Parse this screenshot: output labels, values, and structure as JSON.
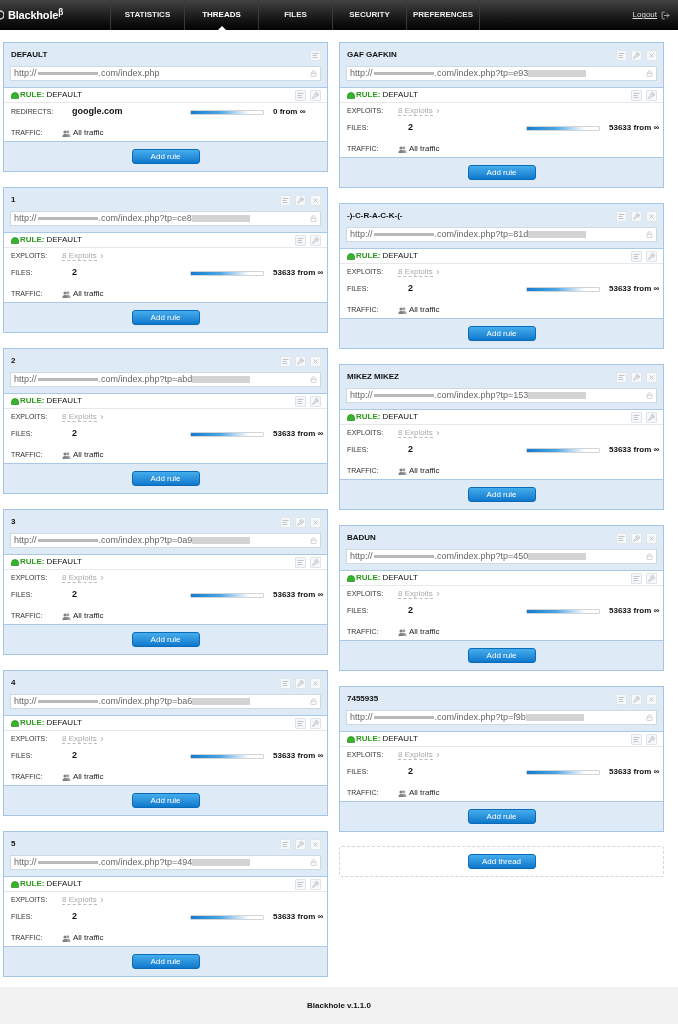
{
  "header": {
    "logo": "Blackhole$^{β}$",
    "nav": [
      {
        "label": "STATISTICS",
        "selected": false
      },
      {
        "label": "THREADS",
        "selected": true
      },
      {
        "label": "FILES",
        "selected": false
      },
      {
        "label": "SECURITY",
        "selected": false
      },
      {
        "label": "PREFERENCES",
        "selected": false
      }
    ],
    "logout": "Logout"
  },
  "columns": [
    [
      {
        "title": "DEFAULT",
        "editable": false,
        "removable": false,
        "url": [
          {
            "kind": "text",
            "text": "http://"
          },
          {
            "kind": "redacted_host"
          },
          {
            "kind": "text",
            "text": ".com/index.php"
          }
        ],
        "rule": {
          "label": "RULE:",
          "name": "DEFAULT"
        },
        "rows": [
          {
            "kind": "meter",
            "label": "REDIRECTS:",
            "value": "google.com",
            "level": 0.8,
            "reading": "0 from ∞"
          },
          {
            "kind": "traffic",
            "label": "TRAFFIC:",
            "value": "All traffic"
          }
        ],
        "button": "Add rule"
      },
      {
        "title": "1",
        "editable": true,
        "removable": true,
        "url": [
          {
            "kind": "text",
            "text": "http://"
          },
          {
            "kind": "redacted_host"
          },
          {
            "kind": "text",
            "text": ".com/index.php?tp=ce8"
          },
          {
            "kind": "redacted_token"
          }
        ],
        "rule": {
          "label": "RULE:",
          "name": "DEFAULT"
        },
        "rows": [
          {
            "kind": "link",
            "label": "EXPLOITS:",
            "value": "8 Exploits"
          },
          {
            "kind": "meter",
            "label": "FILES:",
            "value": "2",
            "level": 0.8,
            "reading": "53633 from ∞"
          },
          {
            "kind": "traffic",
            "label": "TRAFFIC:",
            "value": "All traffic"
          }
        ],
        "button": "Add rule"
      },
      {
        "title": "2",
        "editable": true,
        "removable": true,
        "url": [
          {
            "kind": "text",
            "text": "http://"
          },
          {
            "kind": "redacted_host"
          },
          {
            "kind": "text",
            "text": ".com/index.php?tp=abd"
          },
          {
            "kind": "redacted_token"
          }
        ],
        "rule": {
          "label": "RULE:",
          "name": "DEFAULT"
        },
        "rows": [
          {
            "kind": "link",
            "label": "EXPLOITS:",
            "value": "8 Exploits"
          },
          {
            "kind": "meter",
            "label": "FILES:",
            "value": "2",
            "level": 0.8,
            "reading": "53633 from ∞"
          },
          {
            "kind": "traffic",
            "label": "TRAFFIC:",
            "value": "All traffic"
          }
        ],
        "button": "Add rule"
      },
      {
        "title": "3",
        "editable": true,
        "removable": true,
        "url": [
          {
            "kind": "text",
            "text": "http://"
          },
          {
            "kind": "redacted_host"
          },
          {
            "kind": "text",
            "text": ".com/index.php?tp=0a9"
          },
          {
            "kind": "redacted_token"
          }
        ],
        "rule": {
          "label": "RULE:",
          "name": "DEFAULT"
        },
        "rows": [
          {
            "kind": "link",
            "label": "EXPLOITS:",
            "value": "8 Exploits"
          },
          {
            "kind": "meter",
            "label": "FILES:",
            "value": "2",
            "level": 0.8,
            "reading": "53633 from ∞"
          },
          {
            "kind": "traffic",
            "label": "TRAFFIC:",
            "value": "All traffic"
          }
        ],
        "button": "Add rule"
      },
      {
        "title": "4",
        "editable": true,
        "removable": true,
        "url": [
          {
            "kind": "text",
            "text": "http://"
          },
          {
            "kind": "redacted_host"
          },
          {
            "kind": "text",
            "text": ".com/index.php?tp=ba6"
          },
          {
            "kind": "redacted_token"
          }
        ],
        "rule": {
          "label": "RULE:",
          "name": "DEFAULT"
        },
        "rows": [
          {
            "kind": "link",
            "label": "EXPLOITS:",
            "value": "8 Exploits"
          },
          {
            "kind": "meter",
            "label": "FILES:",
            "value": "2",
            "level": 0.8,
            "reading": "53633 from ∞"
          },
          {
            "kind": "traffic",
            "label": "TRAFFIC:",
            "value": "All traffic"
          }
        ],
        "button": "Add rule"
      },
      {
        "title": "5",
        "editable": true,
        "removable": true,
        "url": [
          {
            "kind": "text",
            "text": "http://"
          },
          {
            "kind": "redacted_host"
          },
          {
            "kind": "text",
            "text": ".com/index.php?tp=494"
          },
          {
            "kind": "redacted_token"
          }
        ],
        "rule": {
          "label": "RULE:",
          "name": "DEFAULT"
        },
        "rows": [
          {
            "kind": "link",
            "label": "EXPLOITS:",
            "value": "8 Exploits"
          },
          {
            "kind": "meter",
            "label": "FILES:",
            "value": "2",
            "level": 0.8,
            "reading": "53633 from ∞"
          },
          {
            "kind": "traffic",
            "label": "TRAFFIC:",
            "value": "All traffic"
          }
        ],
        "button": "Add rule"
      }
    ],
    [
      {
        "title": "GAF GAFKIN",
        "editable": true,
        "removable": true,
        "url": [
          {
            "kind": "text",
            "text": "http://"
          },
          {
            "kind": "redacted_host"
          },
          {
            "kind": "text",
            "text": ".com/index.php?tp=e93"
          },
          {
            "kind": "redacted_token"
          }
        ],
        "rule": {
          "label": "RULE:",
          "name": "DEFAULT"
        },
        "rows": [
          {
            "kind": "link",
            "label": "EXPLOITS:",
            "value": "8 Exploits"
          },
          {
            "kind": "meter",
            "label": "FILES:",
            "value": "2",
            "level": 0.8,
            "reading": "53633 from ∞"
          },
          {
            "kind": "traffic",
            "label": "TRAFFIC:",
            "value": "All traffic"
          }
        ],
        "button": "Add rule"
      },
      {
        "title": "-)-C-R-A-C-K-(-",
        "editable": true,
        "removable": true,
        "url": [
          {
            "kind": "text",
            "text": "http://"
          },
          {
            "kind": "redacted_host"
          },
          {
            "kind": "text",
            "text": ".com/index.php?tp=81d"
          },
          {
            "kind": "redacted_token"
          }
        ],
        "rule": {
          "label": "RULE:",
          "name": "DEFAULT"
        },
        "rows": [
          {
            "kind": "link",
            "label": "EXPLOITS:",
            "value": "8 Exploits"
          },
          {
            "kind": "meter",
            "label": "FILES:",
            "value": "2",
            "level": 0.8,
            "reading": "53633 from ∞"
          },
          {
            "kind": "traffic",
            "label": "TRAFFIC:",
            "value": "All traffic"
          }
        ],
        "button": "Add rule"
      },
      {
        "title": "MIKEZ MIKEZ",
        "editable": true,
        "removable": true,
        "url": [
          {
            "kind": "text",
            "text": "http://"
          },
          {
            "kind": "redacted_host"
          },
          {
            "kind": "text",
            "text": ".com/index.php?tp=153"
          },
          {
            "kind": "redacted_token"
          }
        ],
        "rule": {
          "label": "RULE:",
          "name": "DEFAULT"
        },
        "rows": [
          {
            "kind": "link",
            "label": "EXPLOITS:",
            "value": "8 Exploits"
          },
          {
            "kind": "meter",
            "label": "FILES:",
            "value": "2",
            "level": 0.8,
            "reading": "53633 from ∞"
          },
          {
            "kind": "traffic",
            "label": "TRAFFIC:",
            "value": "All traffic"
          }
        ],
        "button": "Add rule"
      },
      {
        "title": "BADUN",
        "editable": true,
        "removable": true,
        "url": [
          {
            "kind": "text",
            "text": "http://"
          },
          {
            "kind": "redacted_host"
          },
          {
            "kind": "text",
            "text": ".com/index.php?tp=450"
          },
          {
            "kind": "redacted_token"
          }
        ],
        "rule": {
          "label": "RULE:",
          "name": "DEFAULT"
        },
        "rows": [
          {
            "kind": "link",
            "label": "EXPLOITS:",
            "value": "8 Exploits"
          },
          {
            "kind": "meter",
            "label": "FILES:",
            "value": "2",
            "level": 0.8,
            "reading": "53633 from ∞"
          },
          {
            "kind": "traffic",
            "label": "TRAFFIC:",
            "value": "All traffic"
          }
        ],
        "button": "Add rule"
      },
      {
        "title": "7455935",
        "editable": true,
        "removable": true,
        "url": [
          {
            "kind": "text",
            "text": "http://"
          },
          {
            "kind": "redacted_host"
          },
          {
            "kind": "text",
            "text": ".com/index.php?tp=f9b"
          },
          {
            "kind": "redacted_token"
          }
        ],
        "rule": {
          "label": "RULE:",
          "name": "DEFAULT"
        },
        "rows": [
          {
            "kind": "link",
            "label": "EXPLOITS:",
            "value": "8 Exploits"
          },
          {
            "kind": "meter",
            "label": "FILES:",
            "value": "2",
            "level": 0.8,
            "reading": "53633 from ∞"
          },
          {
            "kind": "traffic",
            "label": "TRAFFIC:",
            "value": "All traffic"
          }
        ],
        "button": "Add rule"
      }
    ]
  ],
  "add_thread": "Add thread",
  "footer": "Blackhole v.1.1.0"
}
